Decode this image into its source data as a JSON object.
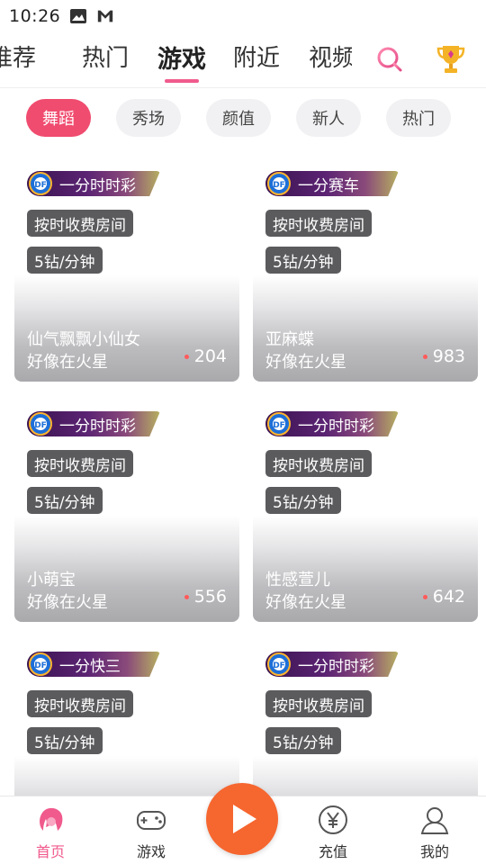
{
  "status_bar": {
    "time": "10:26",
    "icons": [
      "image-icon",
      "mail-icon"
    ]
  },
  "top_tabs": {
    "items": [
      {
        "label": "推荐",
        "active": false
      },
      {
        "label": "热门",
        "active": false
      },
      {
        "label": "游戏",
        "active": true
      },
      {
        "label": "附近",
        "active": false
      },
      {
        "label": "视频",
        "active": false
      }
    ],
    "accent_color": "#f05a8c",
    "icons": [
      "search-icon",
      "trophy-icon"
    ]
  },
  "categories": {
    "items": [
      "舞蹈",
      "秀场",
      "颜值",
      "新人",
      "热门"
    ],
    "active": "舞蹈",
    "active_color": "#f04c6f"
  },
  "cards": [
    {
      "game": "一分时时彩",
      "room_type": "按时收费房间",
      "rate": "5钻/分钟",
      "host": "仙气飘飘小仙女",
      "location": "好像在火星",
      "viewers": "204"
    },
    {
      "game": "一分赛车",
      "room_type": "按时收费房间",
      "rate": "5钻/分钟",
      "host": "亚麻蝶",
      "location": "好像在火星",
      "viewers": "983"
    },
    {
      "game": "一分时时彩",
      "room_type": "按时收费房间",
      "rate": "5钻/分钟",
      "host": "小萌宝",
      "location": "好像在火星",
      "viewers": "556"
    },
    {
      "game": "一分时时彩",
      "room_type": "按时收费房间",
      "rate": "5钻/分钟",
      "host": "性感萱儿",
      "location": "好像在火星",
      "viewers": "642"
    },
    {
      "game": "一分快三",
      "room_type": "按时收费房间",
      "rate": "5钻/分钟",
      "host": "",
      "location": "",
      "viewers": ""
    },
    {
      "game": "一分时时彩",
      "room_type": "按时收费房间",
      "rate": "5钻/分钟",
      "host": "",
      "location": "",
      "viewers": ""
    }
  ],
  "bottom_nav": {
    "items": [
      {
        "label": "首页",
        "icon": "home-girl-icon",
        "active": true
      },
      {
        "label": "游戏",
        "icon": "gamepad-icon",
        "active": false
      },
      {
        "label": "充值",
        "icon": "yen-coin-icon",
        "active": false
      },
      {
        "label": "我的",
        "icon": "profile-icon",
        "active": false
      }
    ],
    "center_button": {
      "icon": "play-icon",
      "color": "#f6662f"
    }
  }
}
